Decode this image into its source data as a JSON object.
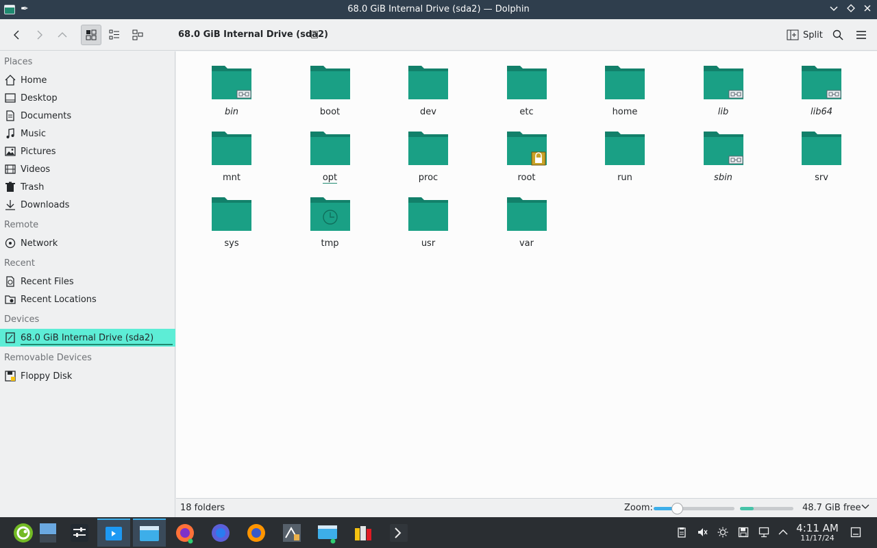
{
  "window": {
    "title": "68.0 GiB Internal Drive (sda2) — Dolphin"
  },
  "toolbar": {
    "breadcrumb": "68.0 GiB Internal Drive (sda2)",
    "split_label": "Split"
  },
  "sidebar": {
    "sections": {
      "places": "Places",
      "remote": "Remote",
      "recent": "Recent",
      "devices": "Devices",
      "removable": "Removable Devices"
    },
    "places": [
      {
        "label": "Home",
        "icon": "home-icon"
      },
      {
        "label": "Desktop",
        "icon": "desktop-icon"
      },
      {
        "label": "Documents",
        "icon": "documents-icon"
      },
      {
        "label": "Music",
        "icon": "music-icon"
      },
      {
        "label": "Pictures",
        "icon": "pictures-icon"
      },
      {
        "label": "Videos",
        "icon": "videos-icon"
      },
      {
        "label": "Trash",
        "icon": "trash-icon"
      },
      {
        "label": "Downloads",
        "icon": "downloads-icon"
      }
    ],
    "remote": [
      {
        "label": "Network",
        "icon": "network-icon"
      }
    ],
    "recent": [
      {
        "label": "Recent Files",
        "icon": "recent-files-icon"
      },
      {
        "label": "Recent Locations",
        "icon": "recent-locations-icon"
      }
    ],
    "devices": [
      {
        "label": "68.0 GiB Internal Drive (sda2)",
        "icon": "drive-icon",
        "selected": true
      }
    ],
    "removable": [
      {
        "label": "Floppy Disk",
        "icon": "floppy-icon"
      }
    ]
  },
  "folders": [
    {
      "name": "bin",
      "italic": true,
      "badge": "link"
    },
    {
      "name": "boot"
    },
    {
      "name": "dev"
    },
    {
      "name": "etc"
    },
    {
      "name": "home"
    },
    {
      "name": "lib",
      "italic": true,
      "badge": "link"
    },
    {
      "name": "lib64",
      "italic": true,
      "badge": "link"
    },
    {
      "name": "mnt"
    },
    {
      "name": "opt",
      "underlined": true
    },
    {
      "name": "proc"
    },
    {
      "name": "root",
      "badge": "lock"
    },
    {
      "name": "run"
    },
    {
      "name": "sbin",
      "italic": true,
      "badge": "link"
    },
    {
      "name": "srv"
    },
    {
      "name": "sys"
    },
    {
      "name": "tmp",
      "badge": "clock"
    },
    {
      "name": "usr"
    },
    {
      "name": "var"
    }
  ],
  "status": {
    "count": "18 folders",
    "zoom_label": "Zoom:",
    "zoom_level": 0.29,
    "free_space": "48.7 GiB free",
    "used_fraction": 0.26
  },
  "taskbar": {
    "clock_time": "4:11 AM",
    "clock_date": "11/17/24"
  },
  "colors": {
    "accent": "#5dedd6",
    "folder": "#1aa085",
    "folder_tab": "#12806a",
    "titlebar": "#2f3e4d",
    "taskbar": "#2a2e32"
  }
}
